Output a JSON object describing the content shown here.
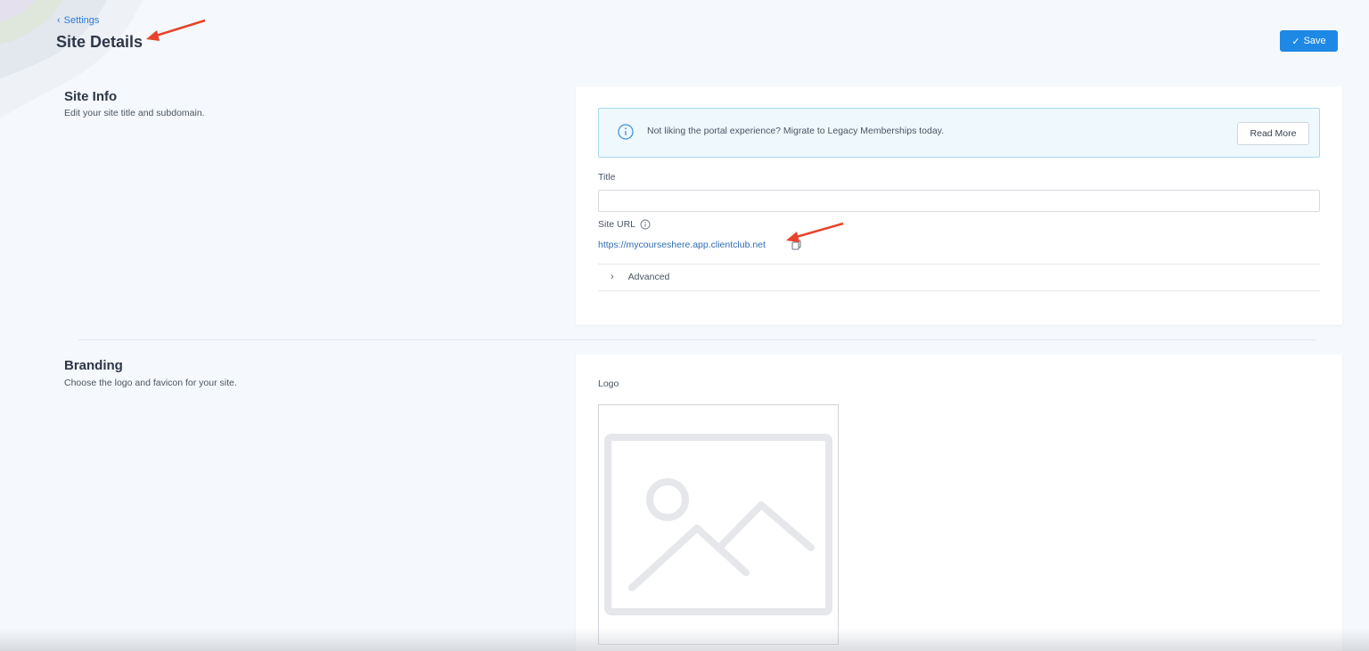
{
  "header": {
    "back_label": "Settings",
    "title": "Site Details",
    "save_label": "Save"
  },
  "site_info": {
    "title": "Site Info",
    "description": "Edit your site title and subdomain.",
    "alert_text": "Not liking the portal experience? Migrate to Legacy Memberships today.",
    "read_more_label": "Read More",
    "title_label": "Title",
    "title_value": "",
    "site_url_label": "Site URL",
    "site_url": "https://mycourseshere.app.clientclub.net",
    "advanced_label": "Advanced"
  },
  "branding": {
    "title": "Branding",
    "description": "Choose the logo and favicon for your site.",
    "logo_label": "Logo"
  },
  "colors": {
    "accent": "#1e88e5",
    "annotation_arrow": "#e8432b",
    "link": "#2f6db3"
  }
}
